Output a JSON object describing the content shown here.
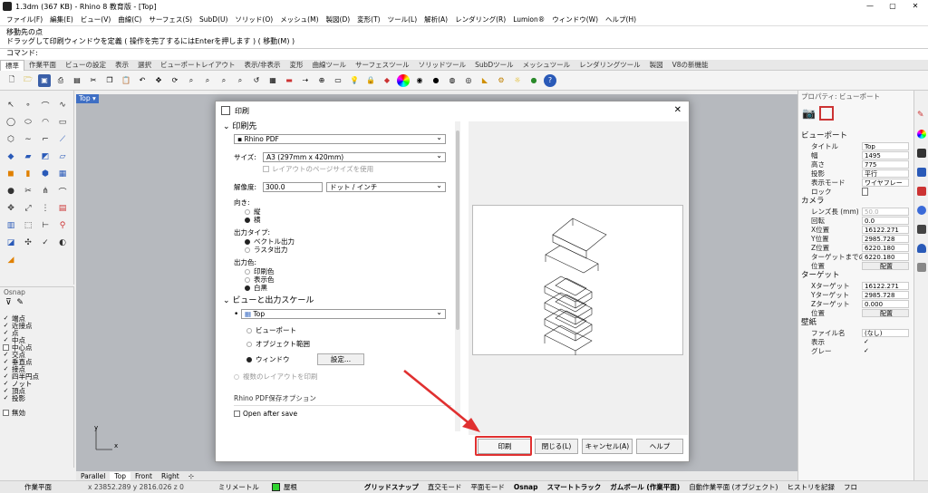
{
  "window": {
    "title": "1.3dm (367 KB) - Rhino 8 教育版 - [Top]",
    "minimize": "—",
    "maximize": "▢",
    "close": "✕"
  },
  "menu": [
    "ファイル(F)",
    "編集(E)",
    "ビュー(V)",
    "曲線(C)",
    "サーフェス(S)",
    "SubD(U)",
    "ソリッド(O)",
    "メッシュ(M)",
    "製図(D)",
    "変形(T)",
    "ツール(L)",
    "解析(A)",
    "レンダリング(R)",
    "Lumion®",
    "ウィンドウ(W)",
    "ヘルプ(H)"
  ],
  "command": {
    "line1": "移動先の点",
    "line2": "ドラッグして印刷ウィンドウを定義 ( 操作を完了するにはEnterを押します ) ( 移動(M) )",
    "prompt": "コマンド:"
  },
  "tabs": [
    "標準",
    "作業平面",
    "ビューの設定",
    "表示",
    "選択",
    "ビューポートレイアウト",
    "表示/非表示",
    "変形",
    "曲線ツール",
    "サーフェスツール",
    "ソリッドツール",
    "SubDツール",
    "メッシュツール",
    "レンダリングツール",
    "製図",
    "V8の新機能"
  ],
  "viewport": {
    "name": "Top",
    "axis_x": "x",
    "axis_y": "y"
  },
  "viewport_tabs": [
    "Parallel",
    "Top",
    "Front",
    "Right"
  ],
  "osnap": {
    "title": "Osnap",
    "items": [
      {
        "label": "端点",
        "checked": true
      },
      {
        "label": "近接点",
        "checked": true
      },
      {
        "label": "点",
        "checked": true
      },
      {
        "label": "中点",
        "checked": true
      },
      {
        "label": "中心点",
        "checked": false
      },
      {
        "label": "交点",
        "checked": true
      },
      {
        "label": "垂直点",
        "checked": true
      },
      {
        "label": "接点",
        "checked": true
      },
      {
        "label": "四半円点",
        "checked": true
      },
      {
        "label": "ノット",
        "checked": true
      },
      {
        "label": "頂点",
        "checked": true
      },
      {
        "label": "投影",
        "checked": true
      },
      {
        "label": "無効",
        "checked": false
      }
    ]
  },
  "properties": {
    "tabs_label": "プロパティ: ビューポート",
    "viewport_section": "ビューポート",
    "viewport": [
      {
        "k": "タイトル",
        "v": "Top"
      },
      {
        "k": "幅",
        "v": "1495"
      },
      {
        "k": "高さ",
        "v": "775"
      },
      {
        "k": "投影",
        "v": "平行"
      },
      {
        "k": "表示モード",
        "v": "ワイヤフレー"
      },
      {
        "k": "ロック",
        "v": ""
      }
    ],
    "camera_section": "カメラ",
    "camera": [
      {
        "k": "レンズ長 (mm)",
        "v": "50.0"
      },
      {
        "k": "回転",
        "v": "0.0"
      },
      {
        "k": "X位置",
        "v": "16122.271"
      },
      {
        "k": "Y位置",
        "v": "2985.728"
      },
      {
        "k": "Z位置",
        "v": "6220.180"
      },
      {
        "k": "ターゲットまでの",
        "v": "6220.180"
      },
      {
        "k": "位置",
        "v": "配置"
      }
    ],
    "target_section": "ターゲット",
    "target": [
      {
        "k": "Xターゲット",
        "v": "16122.271"
      },
      {
        "k": "Yターゲット",
        "v": "2985.728"
      },
      {
        "k": "Zターゲット",
        "v": "0.000"
      },
      {
        "k": "位置",
        "v": "配置"
      }
    ],
    "wallpaper_section": "壁紙",
    "wallpaper": [
      {
        "k": "ファイル名",
        "v": "(なし)"
      },
      {
        "k": "表示",
        "v": "✓"
      },
      {
        "k": "グレー",
        "v": "✓"
      }
    ]
  },
  "dialog": {
    "title": "印刷",
    "printer_section": "印刷先",
    "printer": "Rhino PDF",
    "size_label": "サイズ:",
    "size": "A3 (297mm x 420mm)",
    "layout_page_size": "レイアウトのページサイズを使用",
    "resolution_label": "解像度:",
    "resolution": "300.0",
    "resolution_unit": "ドット / インチ",
    "orientation_label": "向き:",
    "orient_portrait": "縦",
    "orient_landscape": "横",
    "output_type_label": "出力タイプ:",
    "vector": "ベクトル出力",
    "raster": "ラスタ出力",
    "color_label": "出力色:",
    "print_color": "印刷色",
    "display_color": "表示色",
    "bw": "白黒",
    "view_section": "ビューと出力スケール",
    "view": "Top",
    "vp": "ビューポート",
    "extents": "オブジェクト範囲",
    "window": "ウィンドウ",
    "settings": "設定...",
    "multi_layout": "複数のレイアウトを印刷",
    "pdf_options": "Rhino PDF保存オプション",
    "open_after": "Open after save",
    "print_btn": "印刷",
    "close_btn": "閉じる(L)",
    "cancel_btn": "キャンセル(A)",
    "help_btn": "ヘルプ"
  },
  "status": {
    "plane": "作業平面",
    "coords": "x 23852.289  y 2816.026  z 0",
    "units": "ミリメートル",
    "layer": "屋根",
    "grid": "グリッドスナップ",
    "ortho": "直交モード",
    "planar": "平面モード",
    "osnap": "Osnap",
    "smarttrack": "スマートトラック",
    "gumball": "ガムボール (作業平面)",
    "autoplane": "自動作業平面 (オブジェクト)",
    "history": "ヒストリを記録",
    "filter": "フロ"
  },
  "colors": {
    "accent": "#3f6fc4",
    "highlight_red": "#e03030",
    "layer_green": "#2fd32f"
  }
}
